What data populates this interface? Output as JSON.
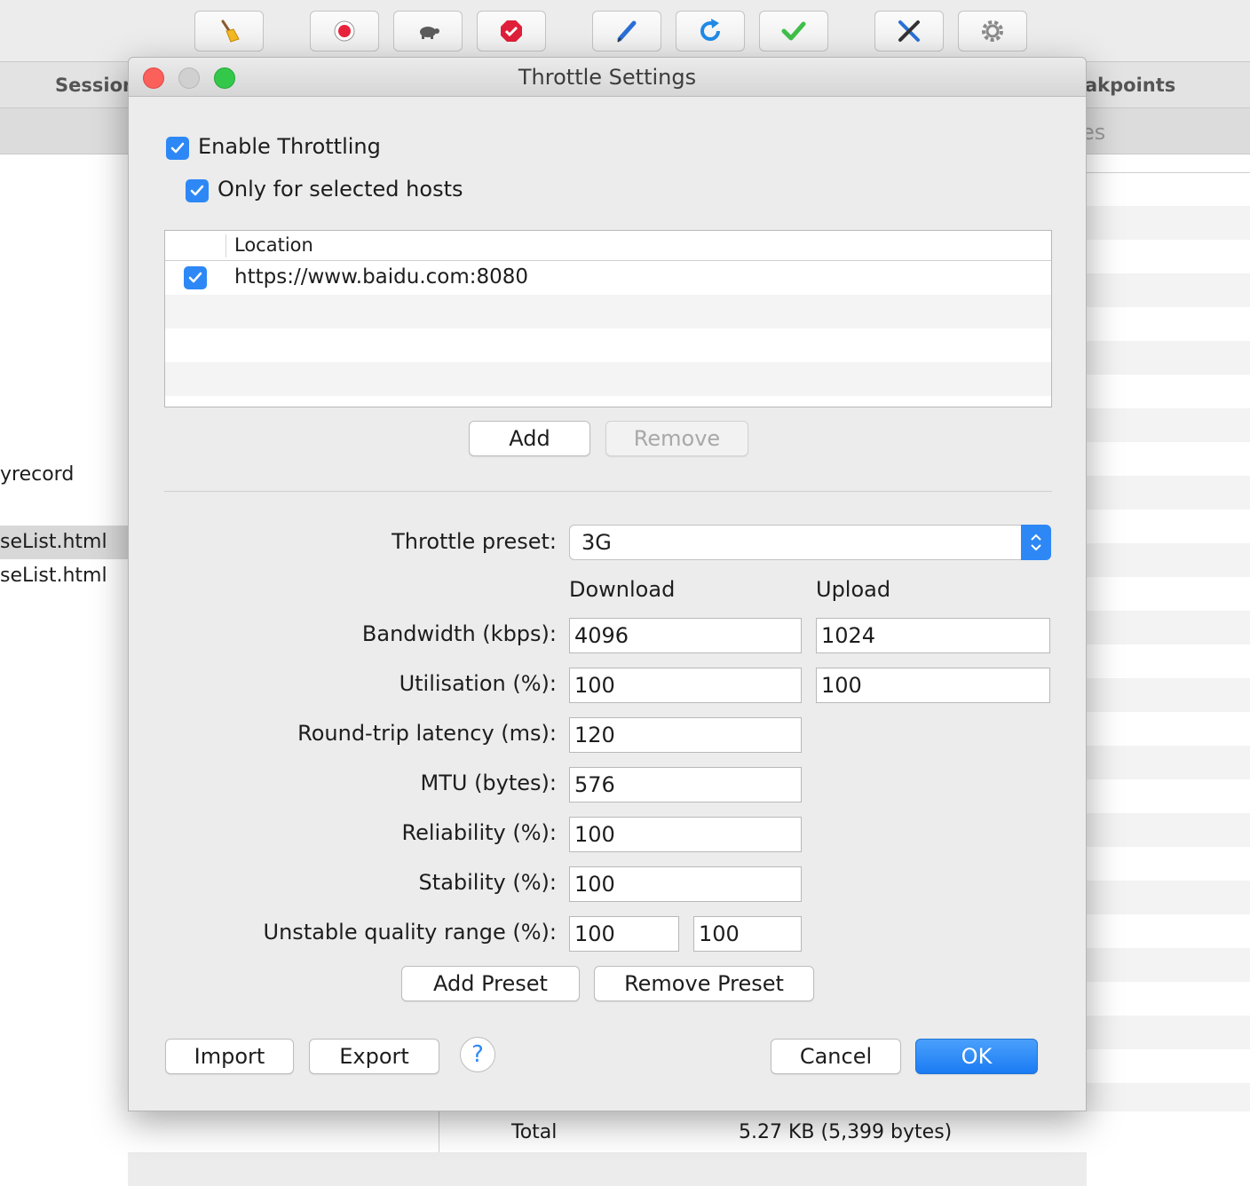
{
  "toolbar": {
    "buttons": [
      {
        "icon": "broom-icon"
      },
      {
        "icon": "record-icon"
      },
      {
        "icon": "turtle-icon"
      },
      {
        "icon": "stop-sign-icon"
      },
      {
        "icon": "pen-icon"
      },
      {
        "icon": "refresh-icon"
      },
      {
        "icon": "checkmark-icon"
      },
      {
        "icon": "tools-icon"
      },
      {
        "icon": "gear-icon"
      }
    ]
  },
  "background": {
    "tab_sessions": "Session",
    "tab_breakpoints": "akpoints",
    "sub_label": "es",
    "left_items": [
      "yrecord",
      "seList.html",
      "seList.html"
    ],
    "total_label": "Total",
    "total_value": "5.27 KB (5,399 bytes)"
  },
  "dialog": {
    "title": "Throttle Settings",
    "enable_throttling": {
      "label": "Enable Throttling",
      "checked": true
    },
    "only_selected_hosts": {
      "label": "Only for selected hosts",
      "checked": true
    },
    "hosts_table": {
      "column": "Location",
      "rows": [
        {
          "enabled": true,
          "location": "https://www.baidu.com:8080"
        }
      ]
    },
    "add_button": "Add",
    "remove_button": "Remove",
    "preset_label": "Throttle preset:",
    "preset_value": "3G",
    "download_header": "Download",
    "upload_header": "Upload",
    "bandwidth_label": "Bandwidth (kbps):",
    "bandwidth_download": "4096",
    "bandwidth_upload": "1024",
    "utilisation_label": "Utilisation (%):",
    "utilisation_download": "100",
    "utilisation_upload": "100",
    "latency_label": "Round-trip latency (ms):",
    "latency_value": "120",
    "mtu_label": "MTU (bytes):",
    "mtu_value": "576",
    "reliability_label": "Reliability (%):",
    "reliability_value": "100",
    "stability_label": "Stability (%):",
    "stability_value": "100",
    "unstable_label": "Unstable quality range (%):",
    "unstable_min": "100",
    "unstable_max": "100",
    "add_preset_button": "Add Preset",
    "remove_preset_button": "Remove Preset",
    "import_button": "Import",
    "export_button": "Export",
    "help_button": "?",
    "cancel_button": "Cancel",
    "ok_button": "OK"
  },
  "colors": {
    "accent": "#2d88f6",
    "close": "#fc605b",
    "maximize": "#34c84a"
  }
}
